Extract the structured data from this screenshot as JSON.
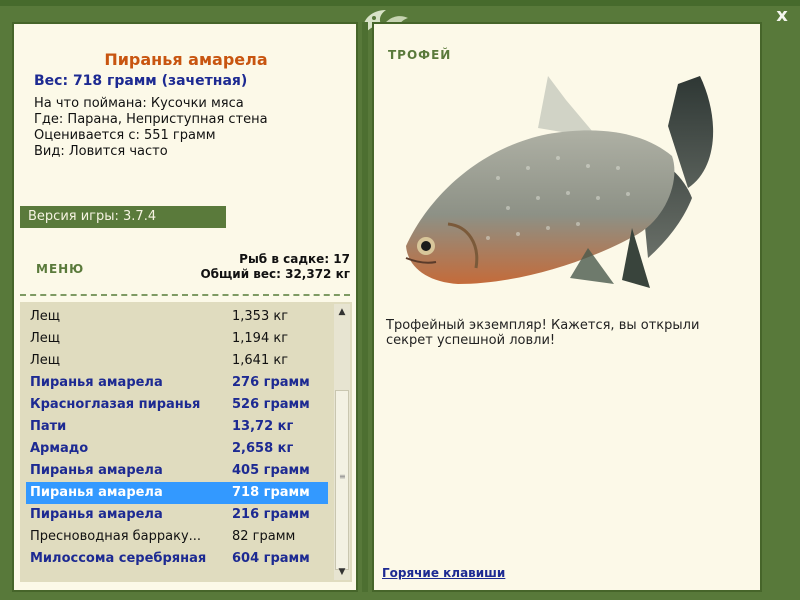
{
  "window": {
    "close_label": "x"
  },
  "catch": {
    "title": "Пиранья амарела",
    "weight_line": "Вес: 718 грамм (зачетная)",
    "bait": "На что поймана: Кусочки мяса",
    "location": "Где: Парана, Неприступная стена",
    "estimated": "Оценивается с: 551 грамм",
    "kind": "Вид: Ловится часто"
  },
  "version": "Версия игры: 3.7.4",
  "menu_label": "МЕНЮ",
  "keepnet": {
    "count_line": "Рыб в садке: 17",
    "total_line": "Общий вес: 32,372 кг"
  },
  "fish_list": [
    {
      "name": "Лещ",
      "weight": "1,353 кг",
      "trophy": false,
      "selected": false
    },
    {
      "name": "Лещ",
      "weight": "1,194 кг",
      "trophy": false,
      "selected": false
    },
    {
      "name": "Лещ",
      "weight": "1,641 кг",
      "trophy": false,
      "selected": false
    },
    {
      "name": "Пиранья амарела",
      "weight": "276 грамм",
      "trophy": true,
      "selected": false
    },
    {
      "name": "Красноглазая пиранья",
      "weight": "526 грамм",
      "trophy": true,
      "selected": false
    },
    {
      "name": "Пати",
      "weight": "13,72 кг",
      "trophy": true,
      "selected": false
    },
    {
      "name": "Армадо",
      "weight": "2,658 кг",
      "trophy": true,
      "selected": false
    },
    {
      "name": "Пиранья амарела",
      "weight": "405 грамм",
      "trophy": true,
      "selected": false
    },
    {
      "name": "Пиранья амарела",
      "weight": "718 грамм",
      "trophy": true,
      "selected": true
    },
    {
      "name": "Пиранья амарела",
      "weight": "216 грамм",
      "trophy": true,
      "selected": false
    },
    {
      "name": "Пресноводная барраку...",
      "weight": "82 грамм",
      "trophy": false,
      "selected": false
    },
    {
      "name": "Милоссома серебряная",
      "weight": "604 грамм",
      "trophy": true,
      "selected": false
    }
  ],
  "trophy": {
    "label": "ТРОФЕЙ",
    "text": "Трофейный экземпляр! Кажется, вы открыли секрет успешной ловли!"
  },
  "hotkeys_label": "Горячие клавиши",
  "colors": {
    "frame_green": "#58793a",
    "panel_bg": "#fcf9e8",
    "title_orange": "#c85510",
    "trophy_blue": "#1d2a92",
    "selection_blue": "#3399ff"
  }
}
